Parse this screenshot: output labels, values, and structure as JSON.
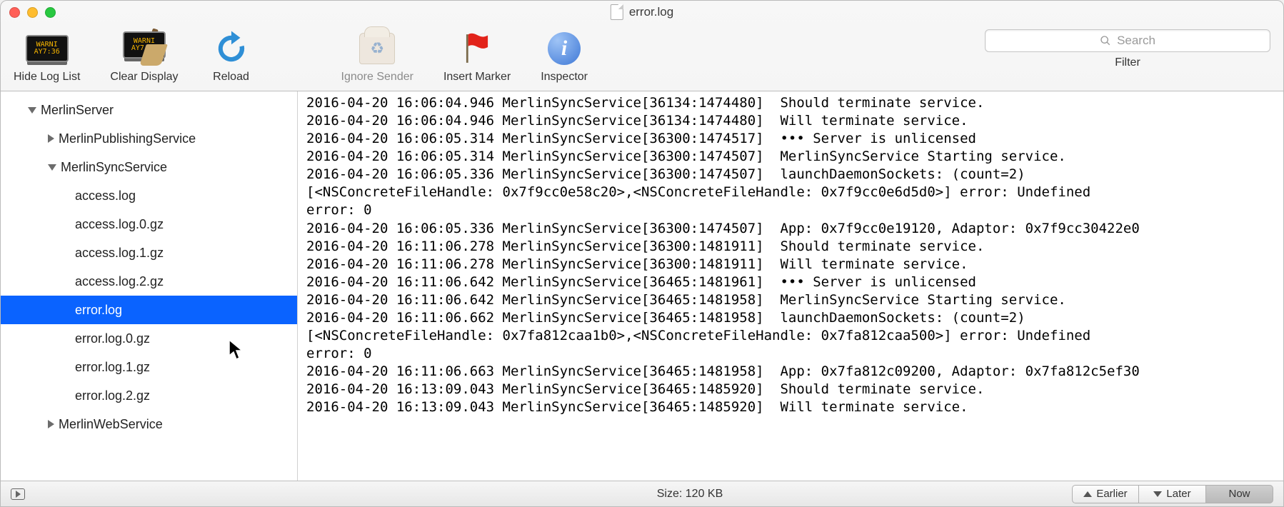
{
  "window": {
    "title": "error.log"
  },
  "toolbar": {
    "hide_log_list": "Hide Log List",
    "clear_display": "Clear Display",
    "reload": "Reload",
    "ignore_sender": "Ignore Sender",
    "insert_marker": "Insert Marker",
    "inspector": "Inspector",
    "search_placeholder": "Search",
    "filter_label": "Filter"
  },
  "sidebar": {
    "root": "MerlinServer",
    "node1": "MerlinPublishingService",
    "node2": "MerlinSyncService",
    "files": {
      "f0": "access.log",
      "f1": "access.log.0.gz",
      "f2": "access.log.1.gz",
      "f3": "access.log.2.gz",
      "f4": "error.log",
      "f5": "error.log.0.gz",
      "f6": "error.log.1.gz",
      "f7": "error.log.2.gz"
    },
    "node3": "MerlinWebService"
  },
  "log": {
    "l00": "2016-04-20 16:06:04.946 MerlinSyncService[36134:1474480]  Should terminate service.",
    "l01": "2016-04-20 16:06:04.946 MerlinSyncService[36134:1474480]  Will terminate service.",
    "l02": "2016-04-20 16:06:05.314 MerlinSyncService[36300:1474517]  ••• Server is unlicensed",
    "l03": "2016-04-20 16:06:05.314 MerlinSyncService[36300:1474507]  MerlinSyncService Starting service.",
    "l04": "2016-04-20 16:06:05.336 MerlinSyncService[36300:1474507]  launchDaemonSockets: (count=2)",
    "l05": "[<NSConcreteFileHandle: 0x7f9cc0e58c20>,<NSConcreteFileHandle: 0x7f9cc0e6d5d0>] error: Undefined",
    "l06": "error: 0",
    "l07": "2016-04-20 16:06:05.336 MerlinSyncService[36300:1474507]  App: 0x7f9cc0e19120, Adaptor: 0x7f9cc30422e0",
    "l08": "2016-04-20 16:11:06.278 MerlinSyncService[36300:1481911]  Should terminate service.",
    "l09": "2016-04-20 16:11:06.278 MerlinSyncService[36300:1481911]  Will terminate service.",
    "l10": "2016-04-20 16:11:06.642 MerlinSyncService[36465:1481961]  ••• Server is unlicensed",
    "l11": "2016-04-20 16:11:06.642 MerlinSyncService[36465:1481958]  MerlinSyncService Starting service.",
    "l12": "2016-04-20 16:11:06.662 MerlinSyncService[36465:1481958]  launchDaemonSockets: (count=2)",
    "l13": "[<NSConcreteFileHandle: 0x7fa812caa1b0>,<NSConcreteFileHandle: 0x7fa812caa500>] error: Undefined",
    "l14": "error: 0",
    "l15": "2016-04-20 16:11:06.663 MerlinSyncService[36465:1481958]  App: 0x7fa812c09200, Adaptor: 0x7fa812c5ef30",
    "l16": "2016-04-20 16:13:09.043 MerlinSyncService[36465:1485920]  Should terminate service.",
    "l17": "2016-04-20 16:13:09.043 MerlinSyncService[36465:1485920]  Will terminate service."
  },
  "statusbar": {
    "size": "Size: 120 KB",
    "earlier": "Earlier",
    "later": "Later",
    "now": "Now"
  }
}
